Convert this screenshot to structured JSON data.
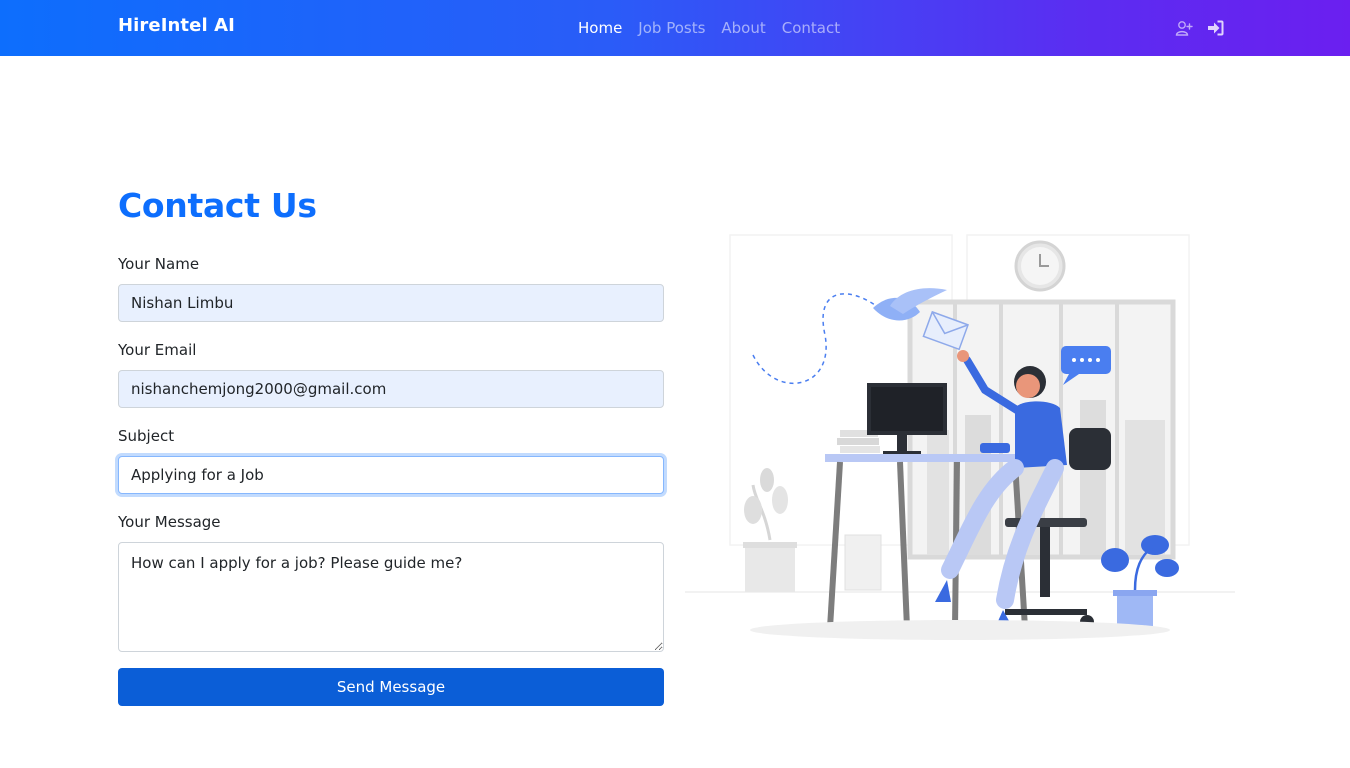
{
  "navbar": {
    "brand": "HireIntel AI",
    "links": [
      {
        "label": "Home",
        "active": true
      },
      {
        "label": "Job Posts",
        "active": false
      },
      {
        "label": "About",
        "active": false
      },
      {
        "label": "Contact",
        "active": false
      }
    ],
    "icons": [
      "user-plus-icon",
      "sign-in-icon"
    ]
  },
  "contact": {
    "heading": "Contact Us",
    "fields": {
      "name": {
        "label": "Your Name",
        "value": "Nishan Limbu"
      },
      "email": {
        "label": "Your Email",
        "value": "nishanchemjong2000@gmail.com"
      },
      "subject": {
        "label": "Subject",
        "value": "Applying for a Job"
      },
      "message": {
        "label": "Your Message",
        "value": "How can I apply for a job? Please guide me?"
      }
    },
    "submit_label": "Send Message"
  },
  "colors": {
    "primary": "#0d6efd",
    "button": "#0b5ed7",
    "navbar_gradient_start": "#0d6efd",
    "navbar_gradient_end": "#6b1ff0",
    "autofill_bg": "#e8f0fe"
  }
}
